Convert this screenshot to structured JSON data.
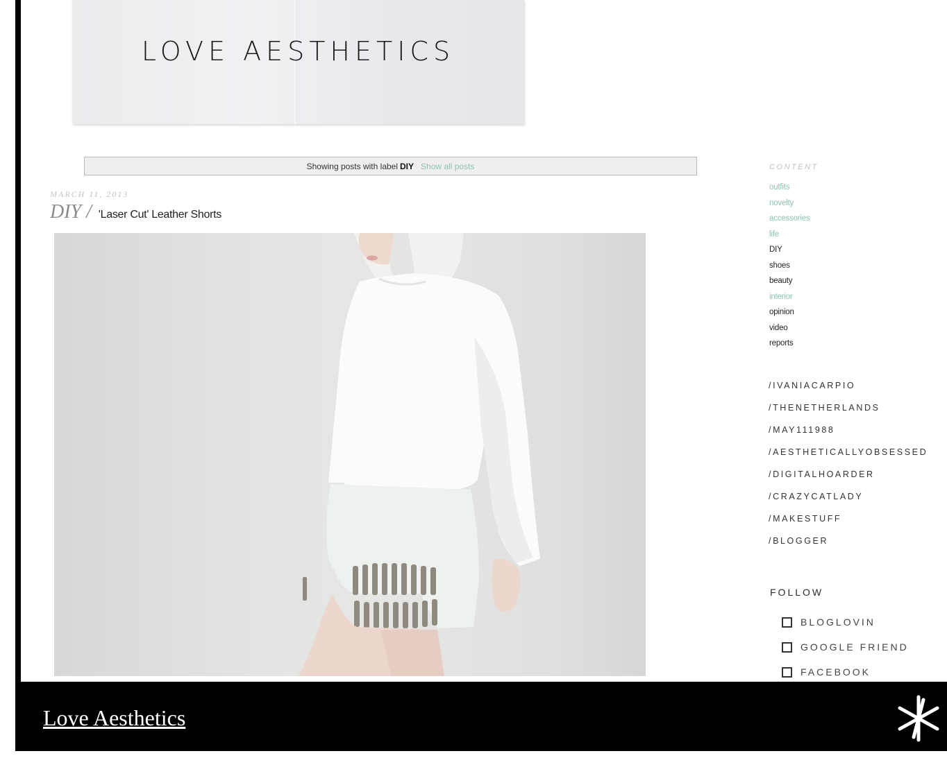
{
  "header": {
    "title": "LOVE AESTHETICS"
  },
  "label_bar": {
    "prefix": "Showing posts with label",
    "label": "DIY",
    "show_all": "Show all posts"
  },
  "post": {
    "date": "MARCH 11, 2013",
    "title_label": "DIY /",
    "title_text": "'Laser Cut' Leather Shorts"
  },
  "sidebar": {
    "content_heading": "CONTENT",
    "categories": [
      {
        "label": "outfits",
        "color": "#8cc4ae"
      },
      {
        "label": "novelty",
        "color": "#8cc4ae"
      },
      {
        "label": "accessories",
        "color": "#8cc4ae"
      },
      {
        "label": "life",
        "color": "#8cc4ae"
      },
      {
        "label": "DIY",
        "color": "#222222"
      },
      {
        "label": "shoes",
        "color": "#222222"
      },
      {
        "label": "beauty",
        "color": "#222222"
      },
      {
        "label": "interior",
        "color": "#8cc4ae"
      },
      {
        "label": "opinion",
        "color": "#222222"
      },
      {
        "label": "video",
        "color": "#222222"
      },
      {
        "label": "reports",
        "color": "#222222"
      }
    ],
    "links": [
      "/IVANIACARPIO",
      "/THENETHERLANDS",
      "/MAY111988",
      "/AESTHETICALLYOBSESSED",
      "/DIGITALHOARDER",
      "/CRAZYCATLADY",
      "/MAKESTUFF",
      "/BLOGGER"
    ],
    "follow_heading": "FOLLOW",
    "follow": [
      "BLOGLOVIN",
      "GOOGLE FRIEND",
      "FACEBOOK"
    ]
  },
  "footer": {
    "title": "Love Aesthetics",
    "icon": "star-icon"
  },
  "colors": {
    "accent": "#8cc4ae",
    "footer_bg": "#000000"
  }
}
